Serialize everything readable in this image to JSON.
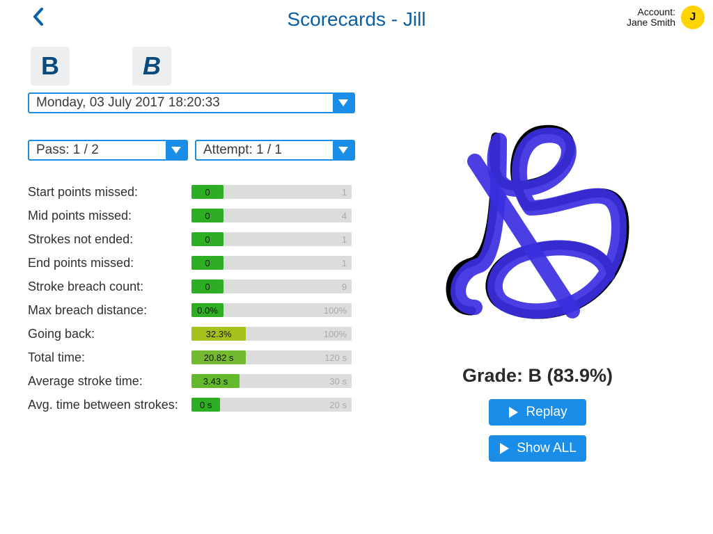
{
  "header": {
    "title": "Scorecards - Jill",
    "account_label": "Account:",
    "account_name": "Jane Smith",
    "avatar_initial": "J"
  },
  "tiles": {
    "normal": "B",
    "italic": "B"
  },
  "selects": {
    "date": "Monday, 03 July 2017 18:20:33",
    "pass": "Pass: 1 / 2",
    "attempt": "Attempt: 1 / 1"
  },
  "metrics": [
    {
      "label": "Start points missed:",
      "value": "0",
      "max": "1",
      "fill_pct": 20,
      "color": "#2eae23"
    },
    {
      "label": "Mid points missed:",
      "value": "0",
      "max": "4",
      "fill_pct": 20,
      "color": "#2eae23"
    },
    {
      "label": "Strokes not ended:",
      "value": "0",
      "max": "1",
      "fill_pct": 20,
      "color": "#2eae23"
    },
    {
      "label": "End points missed:",
      "value": "0",
      "max": "1",
      "fill_pct": 20,
      "color": "#2eae23"
    },
    {
      "label": "Stroke breach count:",
      "value": "0",
      "max": "9",
      "fill_pct": 20,
      "color": "#2eae23"
    },
    {
      "label": "Max breach distance:",
      "value": "0.0%",
      "max": "100%",
      "fill_pct": 20,
      "color": "#2eae23"
    },
    {
      "label": "Going back:",
      "value": "32.3%",
      "max": "100%",
      "fill_pct": 34,
      "color": "#a6c21a"
    },
    {
      "label": "Total time:",
      "value": "20.82 s",
      "max": "120 s",
      "fill_pct": 34,
      "color": "#74ba31"
    },
    {
      "label": "Average stroke time:",
      "value": "3.43 s",
      "max": "30 s",
      "fill_pct": 30,
      "color": "#63b82c"
    },
    {
      "label": "Avg. time between strokes:",
      "value": "0 s",
      "max": "20 s",
      "fill_pct": 18,
      "color": "#2eae23"
    }
  ],
  "grade": "Grade: B (83.9%)",
  "buttons": {
    "replay": "Replay",
    "show_all": "Show ALL"
  },
  "chart_data": {
    "type": "bar",
    "title": "Scorecard metrics",
    "series": [
      {
        "name": "Start points missed",
        "value": 0,
        "max": 1,
        "unit": ""
      },
      {
        "name": "Mid points missed",
        "value": 0,
        "max": 4,
        "unit": ""
      },
      {
        "name": "Strokes not ended",
        "value": 0,
        "max": 1,
        "unit": ""
      },
      {
        "name": "End points missed",
        "value": 0,
        "max": 1,
        "unit": ""
      },
      {
        "name": "Stroke breach count",
        "value": 0,
        "max": 9,
        "unit": ""
      },
      {
        "name": "Max breach distance",
        "value": 0.0,
        "max": 100,
        "unit": "%"
      },
      {
        "name": "Going back",
        "value": 32.3,
        "max": 100,
        "unit": "%"
      },
      {
        "name": "Total time",
        "value": 20.82,
        "max": 120,
        "unit": "s"
      },
      {
        "name": "Average stroke time",
        "value": 3.43,
        "max": 30,
        "unit": "s"
      },
      {
        "name": "Avg. time between strokes",
        "value": 0,
        "max": 20,
        "unit": "s"
      }
    ]
  }
}
